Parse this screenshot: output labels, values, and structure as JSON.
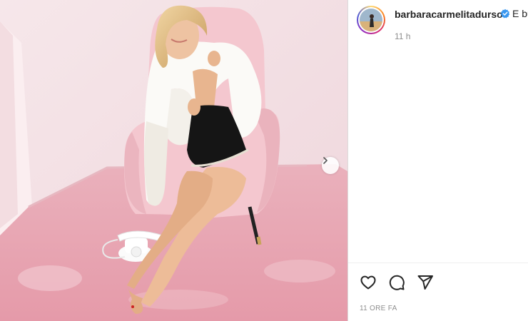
{
  "post": {
    "username": "barbaracarmelitadurso",
    "caption_start": "E bu",
    "time_ago": "11 h",
    "date_label": "11 ORE FA"
  },
  "icons": {
    "verified": "verified-badge-icon",
    "like": "heart-icon",
    "comment": "comment-bubble-icon",
    "share": "paper-plane-icon",
    "next": "chevron-right-icon"
  },
  "colors": {
    "verified": "#3897f0",
    "text": "#262626",
    "muted": "#8e8e8e",
    "photo_wall": "#f4e2e6",
    "photo_carpet": "#e9a7b3"
  }
}
